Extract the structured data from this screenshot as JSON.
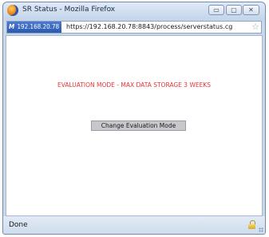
{
  "window": {
    "title": "SR Status - Mozilla Firefox"
  },
  "titlebar_buttons": {
    "minimize": "▭",
    "maximize": "▢",
    "close": "✕"
  },
  "urlbar": {
    "site_mark": "M",
    "site_identity": "192.168.20.78",
    "url": "https://192.168.20.78:8843/process/serverstatus.cg",
    "bookmark_star": "☆"
  },
  "page": {
    "warning": "EVALUATION MODE - MAX DATA STORAGE 3 WEEKS",
    "change_button_label": "Change Evaluation Mode"
  },
  "statusbar": {
    "status": "Done"
  },
  "colors": {
    "warning_text": "#e8333b",
    "site_badge": "#3a69c2",
    "button_face": "#c8c8cc"
  },
  "icons": {
    "app": "firefox-icon",
    "lock": "lock-icon",
    "star": "star-icon"
  }
}
